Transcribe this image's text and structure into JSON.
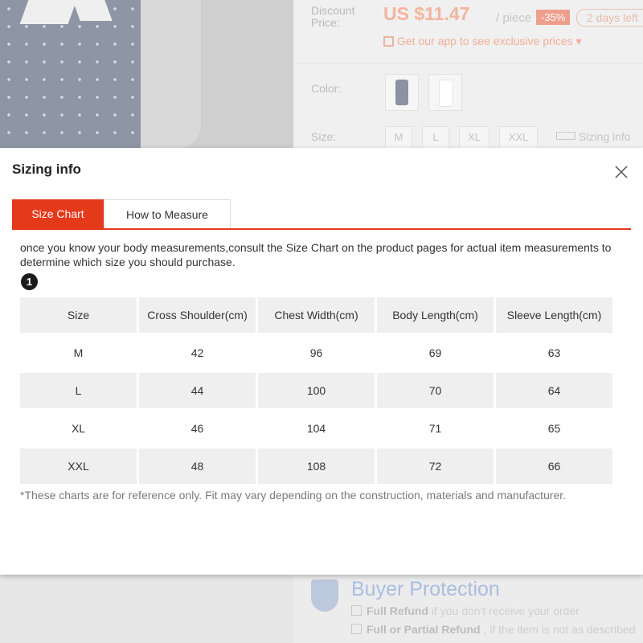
{
  "background": {
    "discount_label": "Discount Price:",
    "price": "US $11.47",
    "per_unit": "/ piece",
    "discount_badge": "-35%",
    "days_left": "2 days left",
    "app_promo": "Get our app to see exclusive prices",
    "color_label": "Color:",
    "size_label": "Size:",
    "sizes": [
      "M",
      "L",
      "XL",
      "XXL"
    ],
    "sizing_link": "Sizing info",
    "buyer_protection": {
      "title": "Buyer Protection",
      "line1_bold": "Full Refund",
      "line1_rest": " if you don't receive your order",
      "line2_bold": "Full or Partial Refund",
      "line2_rest": " , if the item is not as described"
    }
  },
  "modal": {
    "title": "Sizing info",
    "tabs": [
      {
        "label": "Size Chart",
        "active": true
      },
      {
        "label": "How to Measure",
        "active": false
      }
    ],
    "intro": "once you know your body measurements,consult the Size Chart on the product pages for actual item measurements to determine which size you should purchase.",
    "step_number": "1",
    "table": {
      "headers": [
        "Size",
        "Cross Shoulder(cm)",
        "Chest Width(cm)",
        "Body Length(cm)",
        "Sleeve Length(cm)"
      ],
      "rows": [
        [
          "M",
          "42",
          "96",
          "69",
          "63"
        ],
        [
          "L",
          "44",
          "100",
          "70",
          "64"
        ],
        [
          "XL",
          "46",
          "104",
          "71",
          "65"
        ],
        [
          "XXL",
          "48",
          "108",
          "72",
          "66"
        ]
      ]
    },
    "note": "*These charts are for reference only. Fit may vary depending on the construction, materials and manufacturer."
  },
  "colors": {
    "accent": "#e4391b",
    "row_shade": "#efefef"
  }
}
